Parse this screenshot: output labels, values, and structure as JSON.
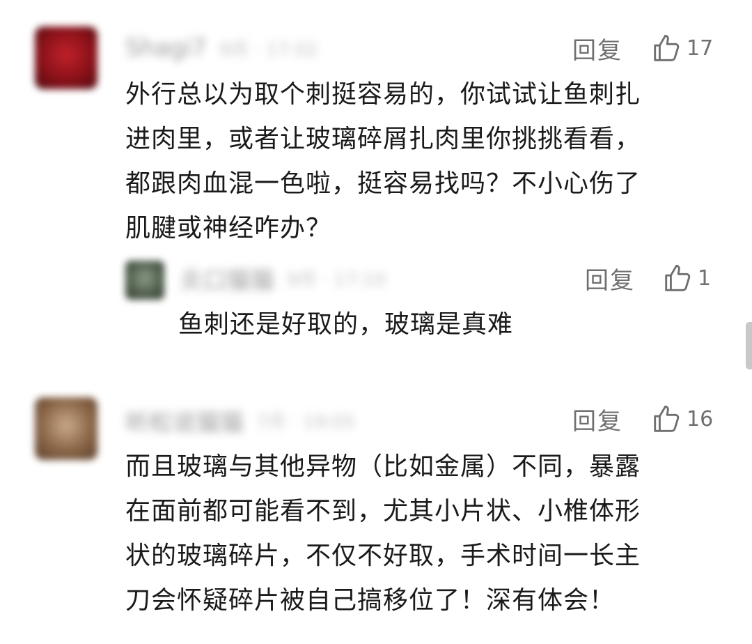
{
  "comments": [
    {
      "user_name": "Shagi7",
      "time": "9月 · 17:02",
      "reply_label": "回复",
      "like_count": "17",
      "avatar_color": "#a3141d",
      "lines": [
        "外行总以为取个刺挺容易的，你试试让鱼刺扎",
        "进肉里，或者让玻璃碎屑扎肉里你挑挑看看，",
        "都跟肉血混一色啦，挺容易找吗？不小心伤了",
        "肌腱或神经咋办？"
      ],
      "reply": {
        "user_name": "炎口猫猫",
        "time": "9月 · 17:10",
        "reply_label": "回复",
        "like_count": "1",
        "text": "鱼刺还是好取的，玻璃是真难"
      }
    },
    {
      "user_name": "听松说猫猫",
      "time": "7月 · 19:05",
      "reply_label": "回复",
      "like_count": "16",
      "avatar_color": "#8a6547",
      "lines": [
        "而且玻璃与其他异物（比如金属）不同，暴露",
        "在面前都可能看不到，尤其小片状、小椎体形",
        "状的玻璃碎片，不仅不好取，手术时间一长主",
        "刀会怀疑碎片被自己搞移位了！深有体会！"
      ]
    }
  ],
  "icons": {
    "like": "thumbs-up-icon"
  },
  "colors": {
    "text": "#1a1a1a",
    "meta": "#6f6f6f",
    "blurred_name": "#9a9a9a",
    "scrollbar": "#c8c8c8"
  }
}
